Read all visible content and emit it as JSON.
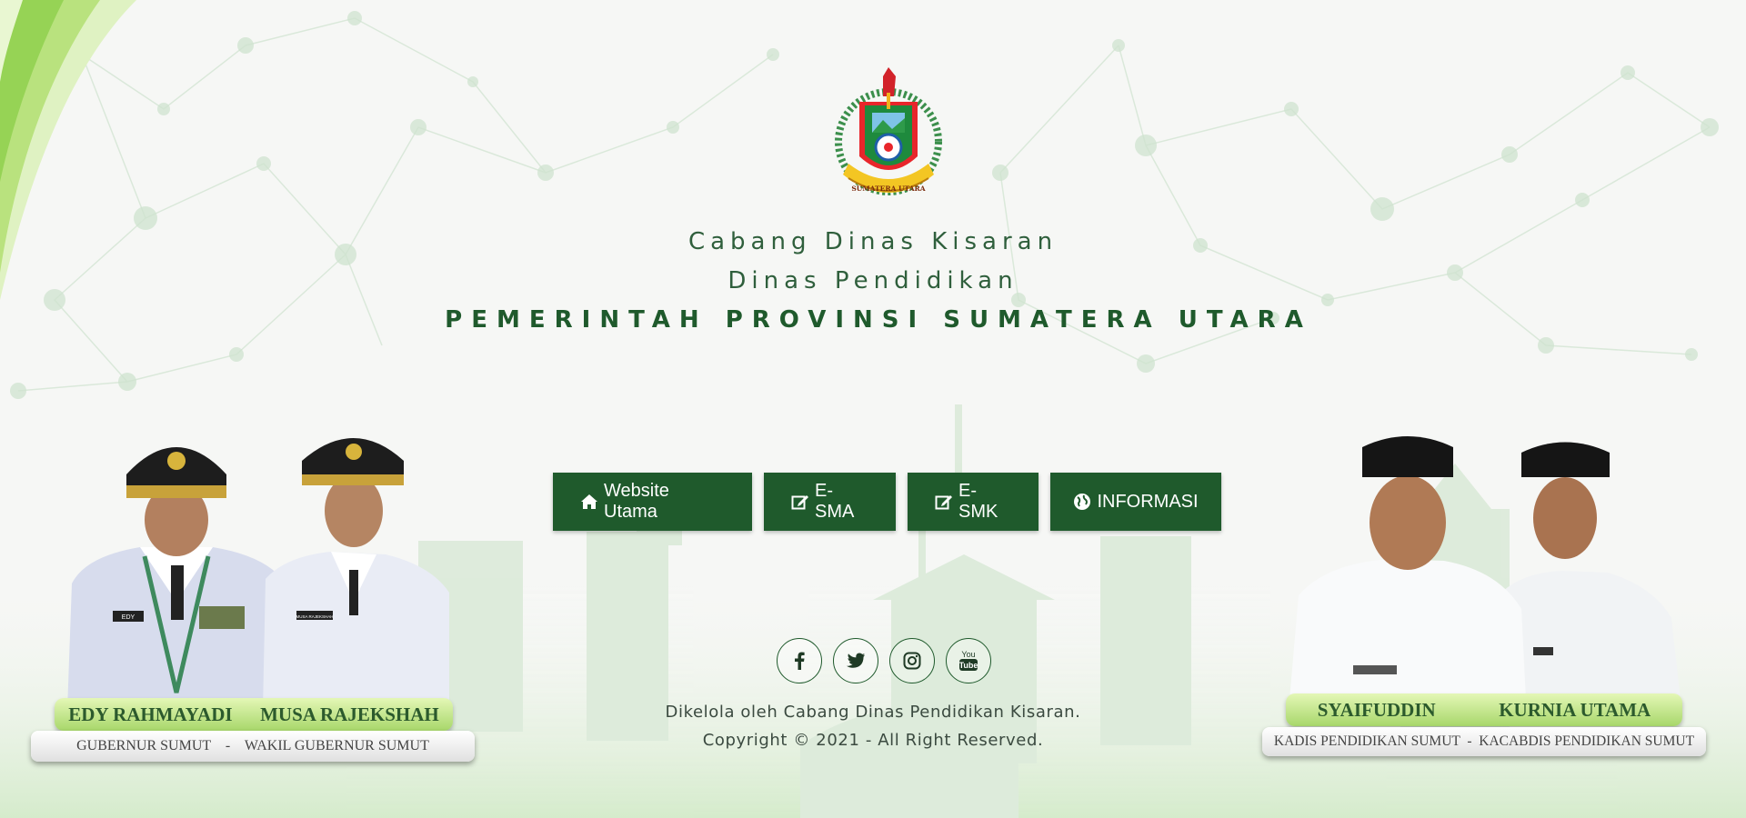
{
  "colors": {
    "primary_green": "#1f5a2c",
    "light_green": "#a8d76b",
    "background": "#f6f7f5"
  },
  "header": {
    "line1": "Cabang Dinas Kisaran",
    "line2": "Dinas Pendidikan",
    "line3": "PEMERINTAH PROVINSI SUMATERA UTARA",
    "emblem_text": "SUMATERA UTARA"
  },
  "nav": {
    "buttons": [
      {
        "label": "Website Utama",
        "icon": "home-icon"
      },
      {
        "label": "E-SMA",
        "icon": "edit-icon"
      },
      {
        "label": "E-SMK",
        "icon": "edit-icon"
      },
      {
        "label": "INFORMASI",
        "icon": "globe-icon"
      }
    ]
  },
  "social": [
    {
      "name": "facebook",
      "icon": "facebook-icon"
    },
    {
      "name": "twitter",
      "icon": "twitter-icon"
    },
    {
      "name": "instagram",
      "icon": "instagram-icon"
    },
    {
      "name": "youtube",
      "icon": "youtube-icon",
      "text": "You Tube"
    }
  ],
  "footer": {
    "managed_by": "Dikelola oleh Cabang Dinas Pendidikan Kisaran.",
    "copyright": "Copyright © 2021 - All Right Reserved."
  },
  "officials_left": {
    "name1": "EDY RAHMAYADI",
    "name2": "MUSA RAJEKSHAH",
    "roles": "GUBERNUR SUMUT    -    WAKIL GUBERNUR SUMUT",
    "badge1": "EDY",
    "badge2": "MUSA RAJEKSHAH"
  },
  "officials_right": {
    "name1": "SYAIFUDDIN",
    "name2": "KURNIA UTAMA",
    "roles": "KADIS PENDIDIKAN SUMUT  -  KACABDIS PENDIDIKAN SUMUT"
  }
}
